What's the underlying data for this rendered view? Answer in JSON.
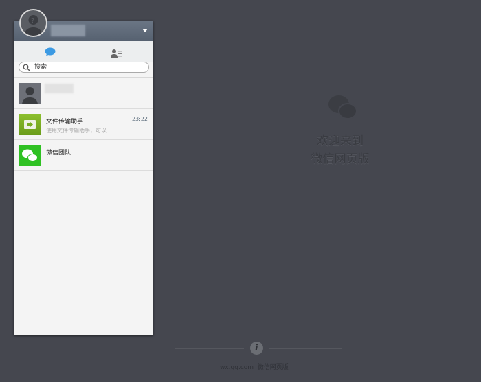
{
  "header": {
    "username": ""
  },
  "search": {
    "placeholder": "搜索"
  },
  "chats": [
    {
      "name": "",
      "message": "",
      "time": ""
    },
    {
      "name": "文件传输助手",
      "message": "使用文件传输助手，可以...",
      "time": "23:22"
    },
    {
      "name": "微信团队",
      "message": "",
      "time": ""
    }
  ],
  "welcome": {
    "line1": "欢迎来到",
    "line2": "微信网页版"
  },
  "footer": {
    "domain": "wx.qq.com",
    "label": "微信网页版"
  },
  "colors": {
    "background": "#45474f",
    "header": "#5d6876",
    "accent_blue": "#3c9ae3",
    "green": "#2fc123"
  }
}
